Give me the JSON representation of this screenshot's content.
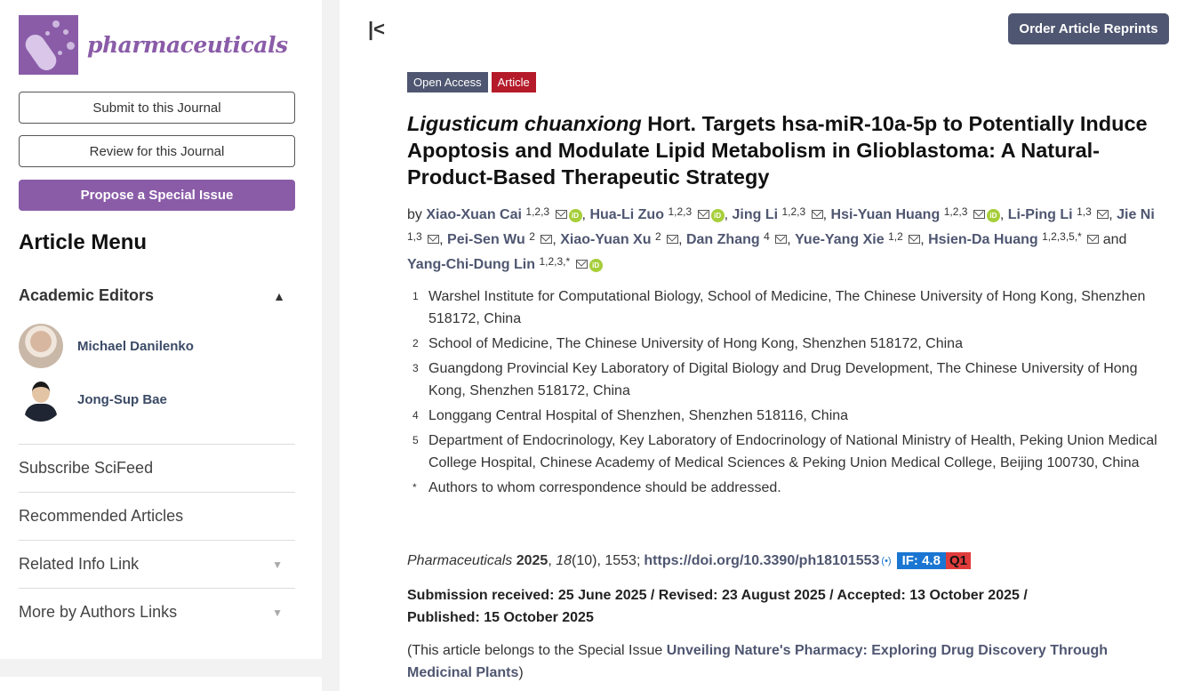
{
  "journal": {
    "name": "pharmaceuticals"
  },
  "sidebar": {
    "submit_label": "Submit to this Journal",
    "review_label": "Review for this Journal",
    "propose_label": "Propose a Special Issue",
    "menu_title": "Article Menu",
    "editors_title": "Academic Editors",
    "editors": [
      {
        "name": "Michael Danilenko"
      },
      {
        "name": "Jong-Sup Bae"
      }
    ],
    "links": [
      {
        "label": "Subscribe SciFeed"
      },
      {
        "label": "Recommended Articles"
      },
      {
        "label": "Related Info Link"
      },
      {
        "label": "More by Authors Links"
      }
    ]
  },
  "header": {
    "reprints_label": "Order Article Reprints",
    "collapse_glyph": "|<"
  },
  "article": {
    "badges": {
      "open_access": "Open Access",
      "type": "Article"
    },
    "title_italic": "Ligusticum chuanxiong",
    "title_rest": " Hort. Targets hsa-miR-10a-5p to Potentially Induce Apoptosis and Modulate Lipid Metabolism in Glioblastoma: A Natural-Product-Based Therapeutic Strategy",
    "by": "by",
    "and": "and",
    "authors": [
      {
        "name": "Xiao-Xuan Cai",
        "aff": "1,2,3",
        "orcid": true
      },
      {
        "name": "Hua-Li Zuo",
        "aff": "1,2,3",
        "orcid": true
      },
      {
        "name": "Jing Li",
        "aff": "1,2,3",
        "orcid": false
      },
      {
        "name": "Hsi-Yuan Huang",
        "aff": "1,2,3",
        "orcid": true
      },
      {
        "name": "Li-Ping Li",
        "aff": "1,3",
        "orcid": false
      },
      {
        "name": "Jie Ni",
        "aff": "1,3",
        "orcid": false
      },
      {
        "name": "Pei-Sen Wu",
        "aff": "2",
        "orcid": false
      },
      {
        "name": "Xiao-Yuan Xu",
        "aff": "2",
        "orcid": false
      },
      {
        "name": "Dan Zhang",
        "aff": "4",
        "orcid": false
      },
      {
        "name": "Yue-Yang Xie",
        "aff": "1,2",
        "orcid": false
      },
      {
        "name": "Hsien-Da Huang",
        "aff": "1,2,3,5,*",
        "orcid": false
      },
      {
        "name": "Yang-Chi-Dung Lin",
        "aff": "1,2,3,*",
        "orcid": true
      }
    ],
    "affiliations": [
      {
        "n": "1",
        "text": "Warshel Institute for Computational Biology, School of Medicine, The Chinese University of Hong Kong, Shenzhen 518172, China"
      },
      {
        "n": "2",
        "text": "School of Medicine, The Chinese University of Hong Kong, Shenzhen 518172, China"
      },
      {
        "n": "3",
        "text": "Guangdong Provincial Key Laboratory of Digital Biology and Drug Development, The Chinese University of Hong Kong, Shenzhen 518172, China"
      },
      {
        "n": "4",
        "text": "Longgang Central Hospital of Shenzhen, Shenzhen 518116, China"
      },
      {
        "n": "5",
        "text": "Department of Endocrinology, Key Laboratory of Endocrinology of National Ministry of Health, Peking Union Medical College Hospital, Chinese Academy of Medical Sciences & Peking Union Medical College, Beijing 100730, China"
      },
      {
        "n": "*",
        "text": "Authors to whom correspondence should be addressed."
      }
    ],
    "citation": {
      "journal": "Pharmaceuticals",
      "year": "2025",
      "volume": "18",
      "issue_pages": "(10), 1553;",
      "doi": "https://doi.org/10.3390/ph18101553",
      "impact_factor": "IF: 4.8",
      "quartile": "Q1"
    },
    "dates_line1": "Submission received: 25 June 2025 / Revised: 23 August 2025 / Accepted: 13 October 2025 /",
    "dates_line2": "Published: 15 October 2025",
    "special_issue_prefix": "(This article belongs to the Special Issue ",
    "special_issue_name": "Unveiling Nature's Pharmacy: Exploring Drug Discovery Through Medicinal Plants",
    "special_issue_suffix": ")"
  },
  "colors": {
    "brand": "#8a5ca8",
    "link": "#4f5671",
    "article_badge": "#b51a2a",
    "if_badge": "#1a76d2",
    "q_badge": "#e03c3c",
    "orcid": "#a6ce39"
  },
  "icons": {
    "envelope": "envelope-icon",
    "orcid": "orcid-icon",
    "chevron": "chevron-icon"
  }
}
